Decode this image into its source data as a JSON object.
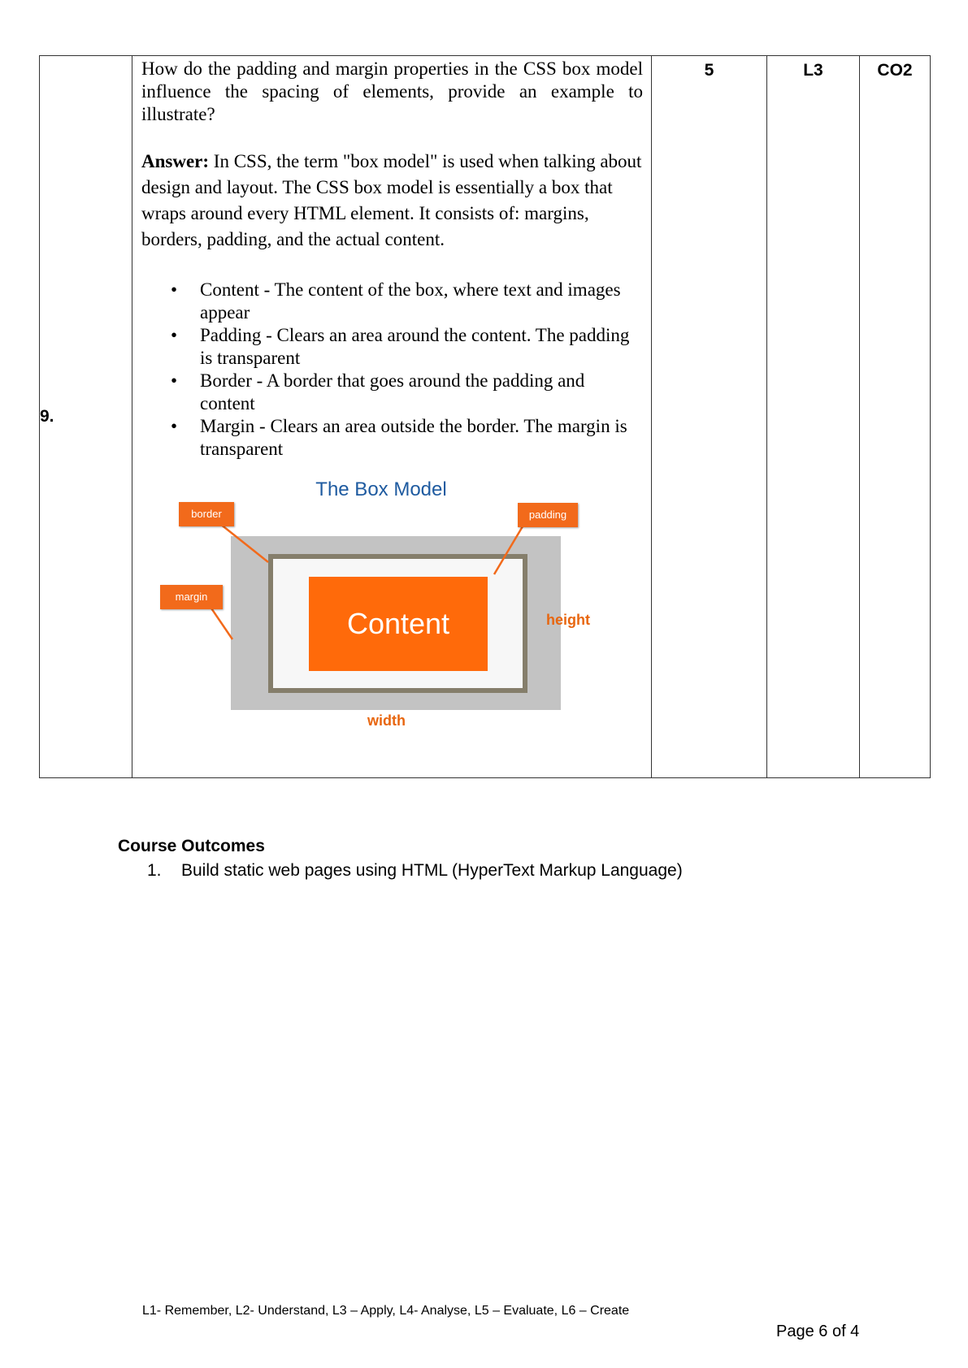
{
  "question": {
    "number": "9.",
    "text": "How do the padding and margin properties in the CSS box model influence the spacing of elements, provide an example to illustrate?",
    "marks": "5",
    "level": "L3",
    "course_outcome": "CO2"
  },
  "answer": {
    "label": "Answer:",
    "text": " In CSS, the term \"box model\" is used when talking about design and layout. The CSS box model is essentially a box that wraps around every HTML element. It consists of: margins, borders, padding, and the actual content.",
    "bullet_symbol": "•",
    "bullets": [
      "Content - The content of the box, where text and images appear",
      "Padding - Clears an area around the content. The padding is transparent",
      "Border - A border that goes around the padding and content",
      "Margin - Clears an area outside the border. The margin is transparent"
    ]
  },
  "diagram": {
    "title": "The Box Model",
    "tags": {
      "border": "border",
      "padding": "padding",
      "margin": "margin"
    },
    "content_label": "Content",
    "height_label": "height",
    "width_label": "width",
    "colors": {
      "title": "#1f5ba0",
      "accent": "#ff6a0a",
      "margin_area": "#c3c3c3",
      "border_line": "#857e6b",
      "padding_area": "#f7f7f7"
    }
  },
  "course_outcomes": {
    "heading": "Course Outcomes",
    "items": [
      {
        "num": "1.",
        "text": "Build static web pages using HTML (HyperText Markup Language)"
      }
    ]
  },
  "footer": {
    "levels": "L1- Remember, L2- Understand, L3 – Apply, L4- Analyse, L5 – Evaluate, L6 – Create",
    "page": "Page 6 of 4"
  }
}
